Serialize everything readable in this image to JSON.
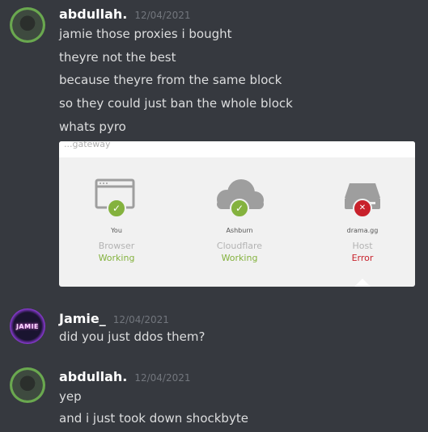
{
  "messages": [
    {
      "username": "abdullah.",
      "timestamp": "12/04/2021",
      "lines": [
        "jamie those proxies i bought",
        "theyre not the best",
        "because theyre from the same block",
        "so they could just ban the whole block",
        "whats pyro"
      ]
    },
    {
      "username": "Jamie_",
      "timestamp": "12/04/2021",
      "avatar_text": "JAMIE",
      "lines": [
        "did you just ddos them?"
      ]
    },
    {
      "username": "abdullah.",
      "timestamp": "12/04/2021",
      "lines": [
        "yep",
        "and i just took down shockbyte"
      ]
    }
  ],
  "embed": {
    "cut_text": "...gateway",
    "nodes": [
      {
        "place": "You",
        "type": "Browser",
        "status": "Working",
        "icon": "browser-icon",
        "state": "ok"
      },
      {
        "place": "Ashburn",
        "type": "Cloudflare",
        "status": "Working",
        "icon": "cloud-icon",
        "state": "ok"
      },
      {
        "place": "drama.gg",
        "type": "Host",
        "status": "Error",
        "icon": "server-icon",
        "state": "error"
      }
    ]
  },
  "colors": {
    "background": "#36393f",
    "username": "#ffffff",
    "timestamp": "#72767d",
    "message_text": "#dcddde",
    "status_ok": "#84b23e",
    "status_error": "#c8212b"
  }
}
